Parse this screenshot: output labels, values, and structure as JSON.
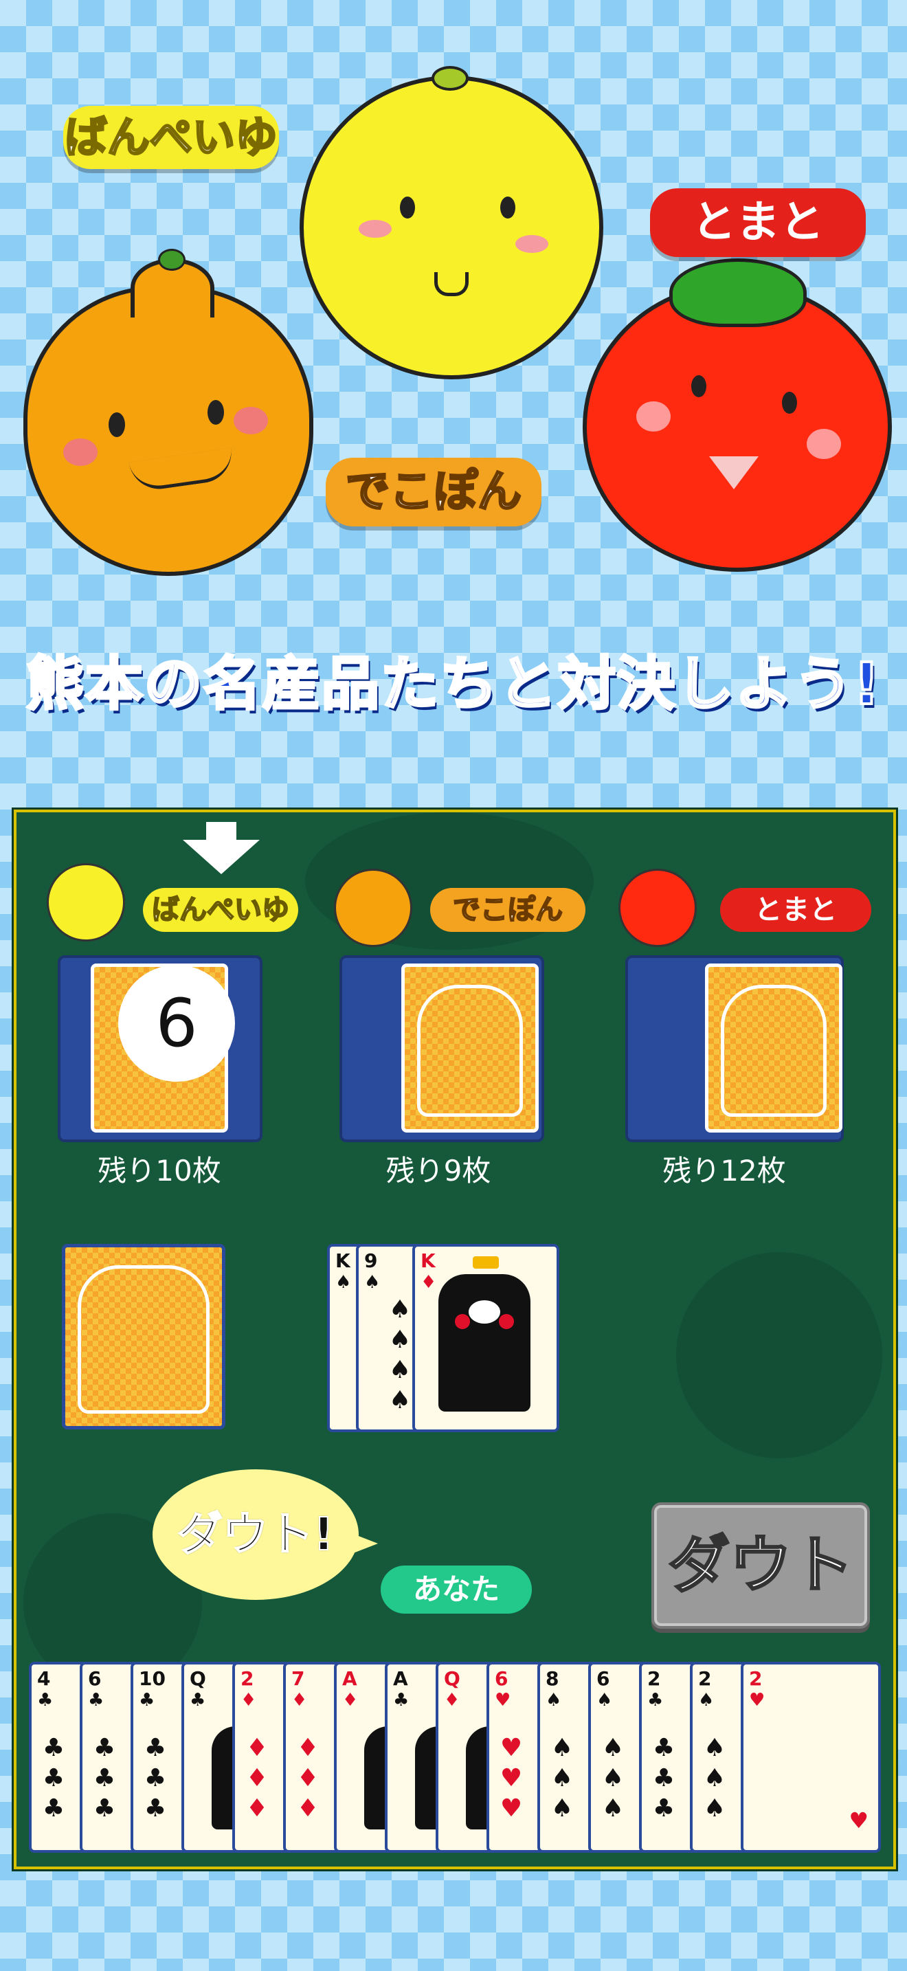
{
  "promo": {
    "char_names": {
      "banpeiyu": "ばんぺいゆ",
      "dekopon": "でこぽん",
      "tomato": "とまと"
    },
    "headline": "熊本の名産品たちと対決しよう!"
  },
  "game": {
    "players": [
      {
        "name": "ばんぺいゆ",
        "remaining": "残り10枚",
        "color": "#f6ee2a"
      },
      {
        "name": "でこぽん",
        "remaining": "残り9枚",
        "color": "#f4a321"
      },
      {
        "name": "とまと",
        "remaining": "残り12枚",
        "color": "#e4221b"
      }
    ],
    "current_number": "6",
    "doubt_bubble": "ダウト!",
    "you_label": "あなた",
    "doubt_button": "ダウト",
    "table_cards": [
      {
        "rank": "K",
        "suit": "♠"
      },
      {
        "rank": "9",
        "suit": "♠"
      },
      {
        "rank": "K",
        "suit": "♦"
      }
    ],
    "hand": [
      {
        "rank": "4",
        "suit": "♣"
      },
      {
        "rank": "6",
        "suit": "♣"
      },
      {
        "rank": "10",
        "suit": "♣"
      },
      {
        "rank": "Q",
        "suit": "♣"
      },
      {
        "rank": "2",
        "suit": "♦"
      },
      {
        "rank": "7",
        "suit": "♦"
      },
      {
        "rank": "A",
        "suit": "♦"
      },
      {
        "rank": "A",
        "suit": "♣"
      },
      {
        "rank": "Q",
        "suit": "♦"
      },
      {
        "rank": "6",
        "suit": "♥"
      },
      {
        "rank": "8",
        "suit": "♠"
      },
      {
        "rank": "6",
        "suit": "♠"
      },
      {
        "rank": "2",
        "suit": "♣"
      },
      {
        "rank": "2",
        "suit": "♠"
      },
      {
        "rank": "2",
        "suit": "♥"
      }
    ]
  }
}
